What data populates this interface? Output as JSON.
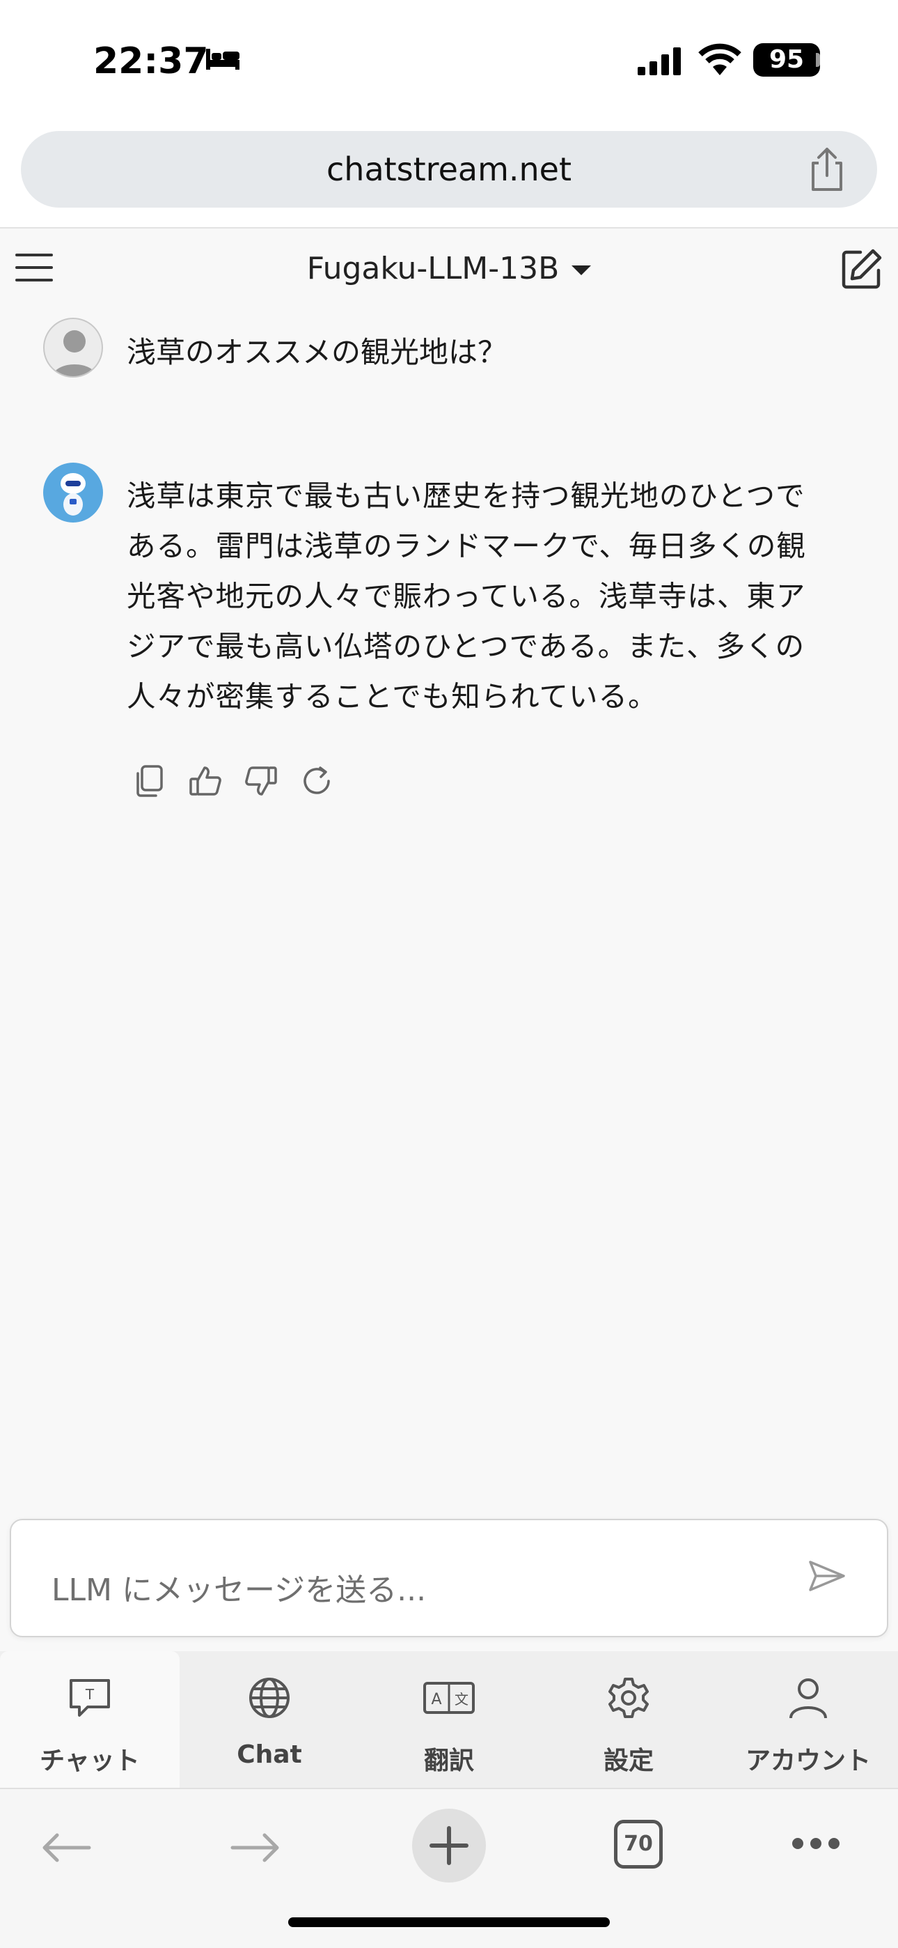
{
  "status": {
    "time": "22:37",
    "battery": "95"
  },
  "browser": {
    "url": "chatstream.net",
    "tab_count": "70"
  },
  "header": {
    "model": "Fugaku-LLM-13B"
  },
  "chat": {
    "user_message": "浅草のオススメの観光地は？",
    "bot_lines": [
      "浅草は東京で最も古い歴史を持つ観光地のひとつで",
      "ある。雷門は浅草のランドマークで、毎日多くの観",
      "光客や地元の人々で賑わっている。浅草寺は、東ア",
      "ジアで最も高い仏塔のひとつである。また、多くの",
      "人々が密集することでも知られている。"
    ]
  },
  "input": {
    "placeholder": "LLM にメッセージを送る..."
  },
  "tabs": [
    {
      "label": "チャット",
      "icon": "chat-text-icon"
    },
    {
      "label": "Chat",
      "icon": "globe-icon"
    },
    {
      "label": "翻訳",
      "icon": "translate-icon"
    },
    {
      "label": "設定",
      "icon": "gear-icon"
    },
    {
      "label": "アカウント",
      "icon": "person-icon"
    }
  ],
  "colors": {
    "bot_avatar": "#58a8e0",
    "active_tab_bg": "#f9f9f9"
  }
}
